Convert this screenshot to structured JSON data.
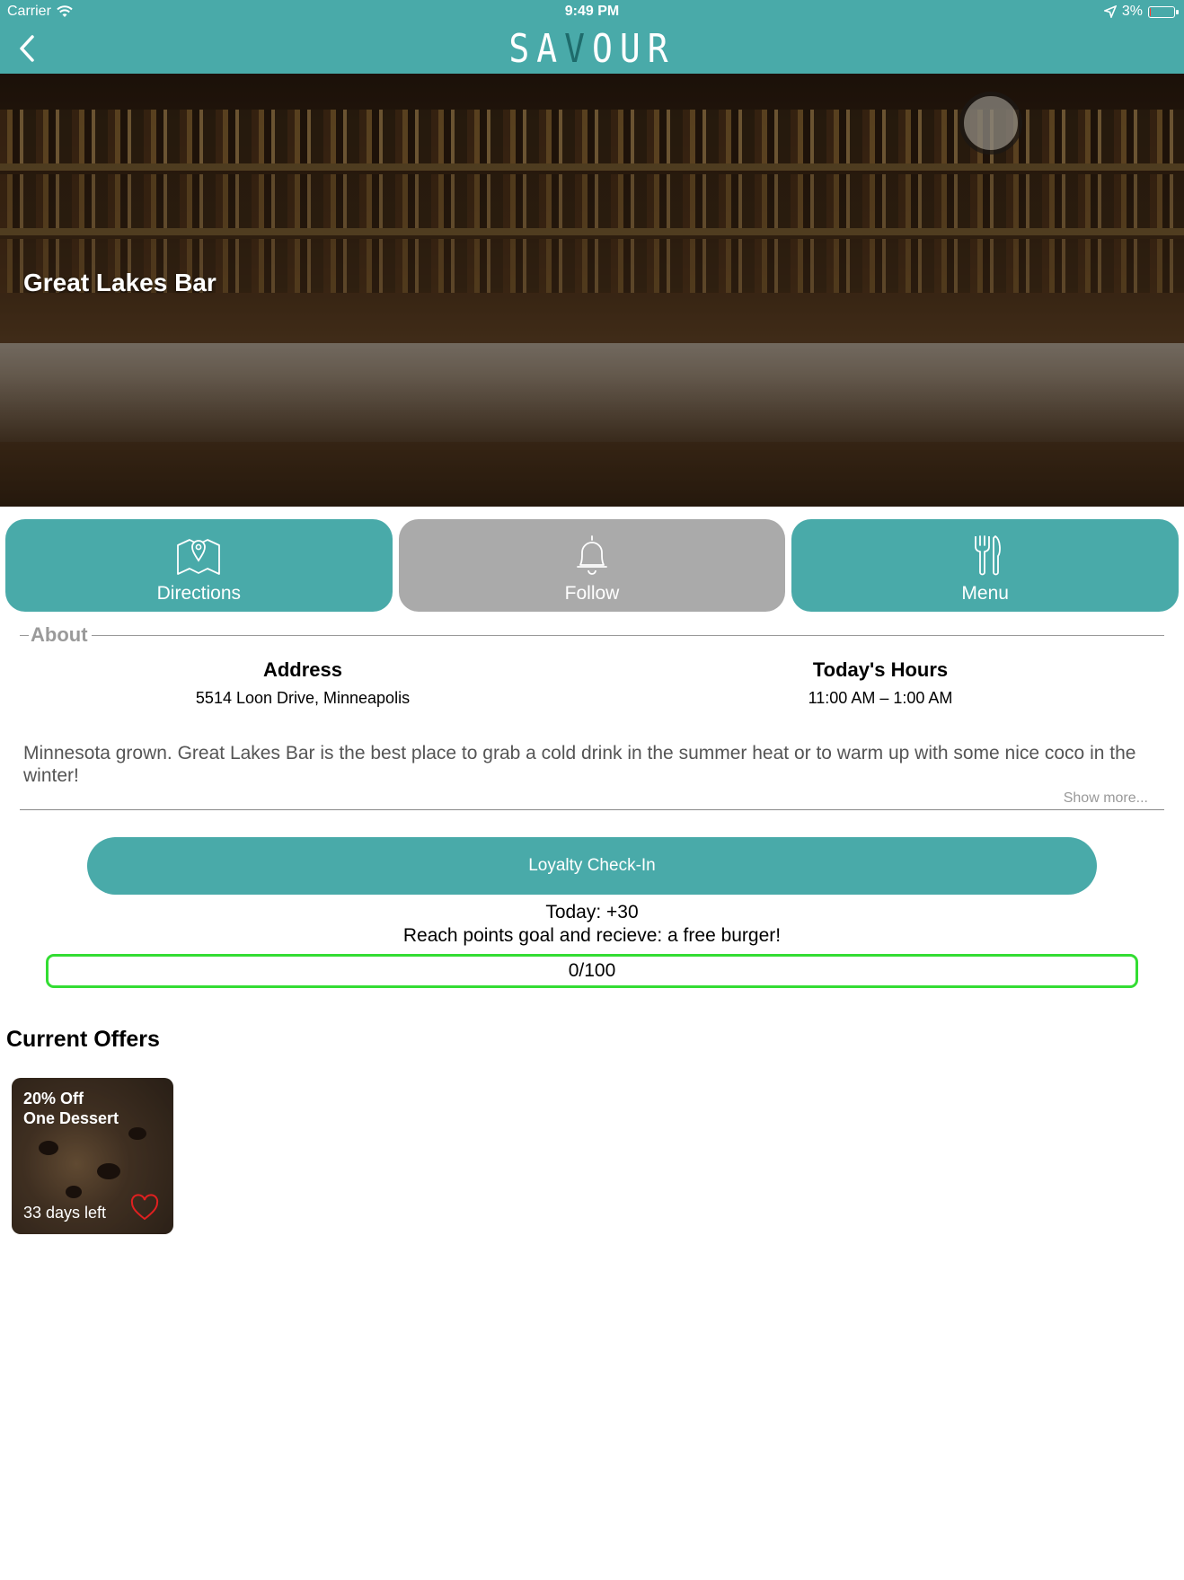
{
  "status_bar": {
    "carrier": "Carrier",
    "time": "9:49 PM",
    "battery": "3%",
    "battery_level": 0.03
  },
  "header": {
    "logo_left": "SA",
    "logo_accent": "V",
    "logo_right": "OUR",
    "back_icon": "chevron-left-icon"
  },
  "hero": {
    "venue_name": "Great Lakes Bar"
  },
  "actions": [
    {
      "label": "Directions",
      "icon": "map-pin-icon",
      "active": true
    },
    {
      "label": "Follow",
      "icon": "bell-icon",
      "active": false
    },
    {
      "label": "Menu",
      "icon": "fork-knife-icon",
      "active": true
    }
  ],
  "about": {
    "label": "About",
    "address_title": "Address",
    "address_value": "5514 Loon Drive, Minneapolis",
    "hours_title": "Today's Hours",
    "hours_value": "11:00 AM – 1:00 AM",
    "description": "Minnesota grown. Great Lakes Bar is the best place to grab a cold drink in the summer heat or to warm up with some nice coco in the winter!",
    "show_more": "Show more..."
  },
  "loyalty": {
    "button_label": "Loyalty Check-In",
    "today": "Today: +30",
    "goal_text": "Reach points goal and recieve: a free burger!",
    "progress_text": "0/100",
    "progress_value": 0
  },
  "offers": {
    "title": "Current Offers",
    "items": [
      {
        "title_line1": "20% Off",
        "title_line2": "One Dessert",
        "days_left": "33 days left",
        "icon": "heart-icon"
      }
    ]
  },
  "colors": {
    "brand": "#49aaa9",
    "inactive": "#aaaaaa",
    "progress": "#33dd33",
    "heart": "#e02020"
  }
}
